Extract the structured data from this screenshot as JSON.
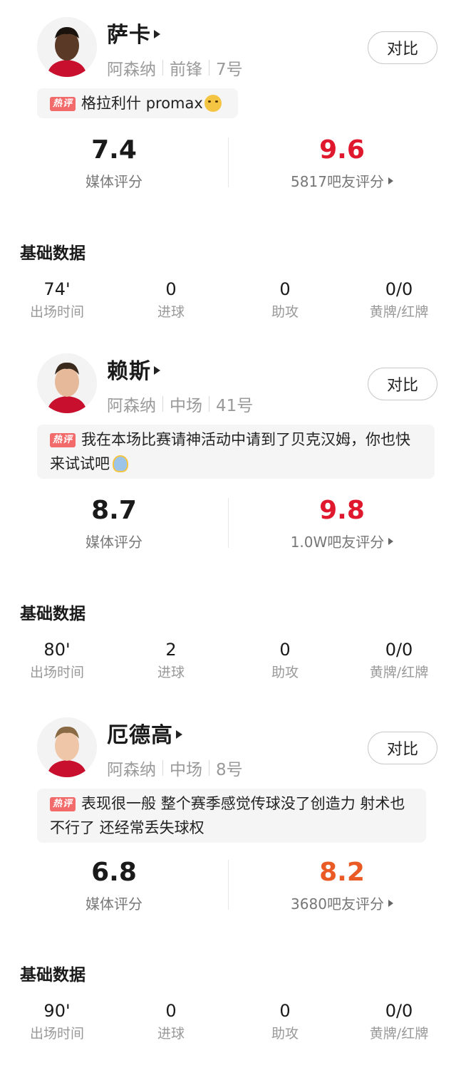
{
  "compare_label": "对比",
  "hot_label": "热评",
  "section_title": "基础数据",
  "rating_media_label": "媒体评分",
  "stat_labels": [
    "出场时间",
    "进球",
    "助攻",
    "黄牌/红牌"
  ],
  "players": [
    {
      "name": "萨卡",
      "team": "阿森纳",
      "position": "前锋",
      "number": "7号",
      "comment": "格拉利什 promax",
      "comment_emoji": "crying-laughing-emoji",
      "media_rating": "7.4",
      "fan_rating": "9.6",
      "fan_rating_color": "#e0182d",
      "fan_count_label": "5817吧友评分",
      "stats": [
        "74'",
        "0",
        "0",
        "0/0"
      ]
    },
    {
      "name": "赖斯",
      "team": "阿森纳",
      "position": "中场",
      "number": "41号",
      "comment": "我在本场比赛请神活动中请到了贝克汉姆，你也快来试试吧",
      "comment_emoji": "praying-person-emoji",
      "media_rating": "8.7",
      "fan_rating": "9.8",
      "fan_rating_color": "#e0182d",
      "fan_count_label": "1.0W吧友评分",
      "stats": [
        "80'",
        "2",
        "0",
        "0/0"
      ]
    },
    {
      "name": "厄德高",
      "team": "阿森纳",
      "position": "中场",
      "number": "8号",
      "comment": "表现很一般 整个赛季感觉传球没了创造力 射术也不行了 还经常丢失球权",
      "comment_emoji": "",
      "media_rating": "6.8",
      "fan_rating": "8.2",
      "fan_rating_color": "#ea5a25",
      "fan_count_label": "3680吧友评分",
      "stats": [
        "90'",
        "0",
        "0",
        "0/0"
      ]
    }
  ]
}
